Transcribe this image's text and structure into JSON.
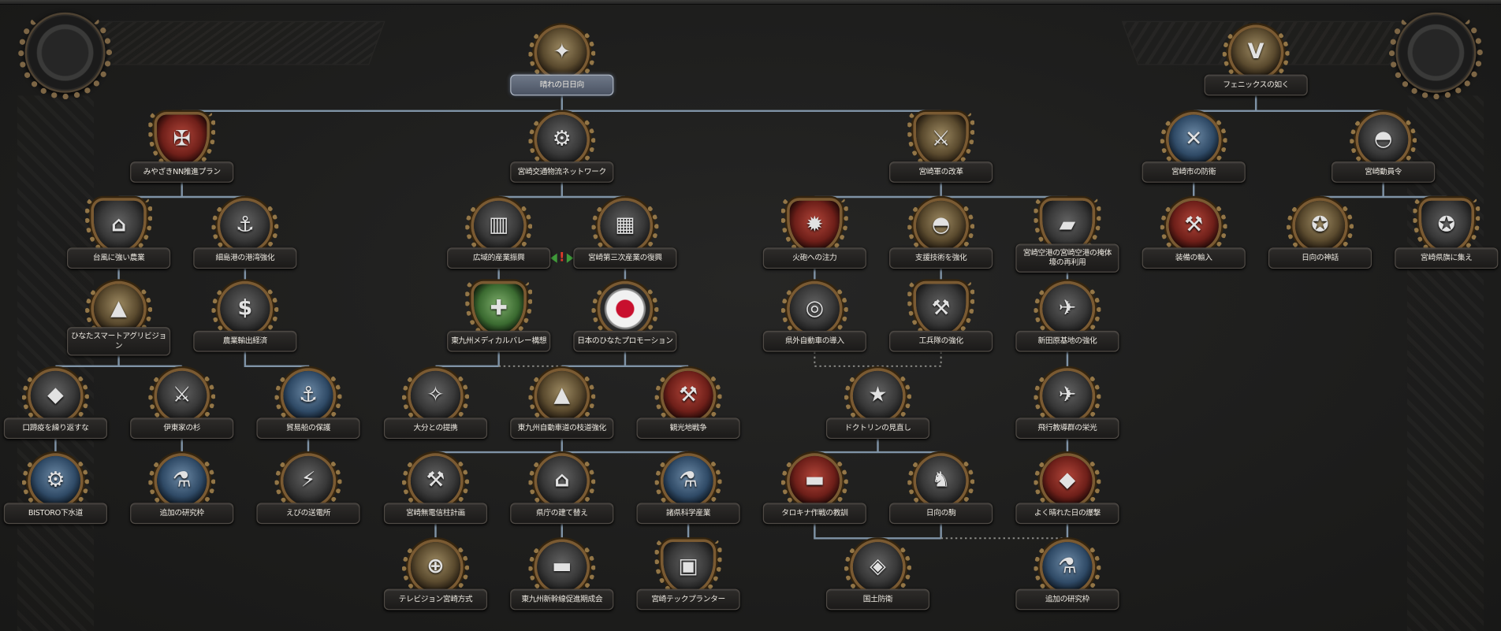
{
  "focus_tree": {
    "focuses": [
      {
        "label": "晴れの日日向",
        "icon": "torch-icon"
      },
      {
        "label": "フェニックスの如く",
        "icon": "phoenix-v-icon"
      },
      {
        "label": "みやざきNN推進プラン",
        "icon": "iron-cross-icon"
      },
      {
        "label": "宮崎交通物流ネットワーク",
        "icon": "logistics-icon"
      },
      {
        "label": "宮崎軍の改革",
        "icon": "crossed-swords-icon"
      },
      {
        "label": "宮崎市の防衛",
        "icon": "crossed-rifles-icon"
      },
      {
        "label": "宮崎動員令",
        "icon": "helmet-icon"
      },
      {
        "label": "台風に強い農業",
        "icon": "farm-icon"
      },
      {
        "label": "細島港の港湾強化",
        "icon": "port-icon"
      },
      {
        "label": "広域的産業振興",
        "icon": "factory-icon"
      },
      {
        "label": "宮崎第三次産業の復興",
        "icon": "city-icon"
      },
      {
        "label": "火砲への注力",
        "icon": "artillery-icon"
      },
      {
        "label": "支援技術を強化",
        "icon": "pith-helmet-icon"
      },
      {
        "label": "宮崎空港の宮崎空港の掩体壕の再利用",
        "icon": "bunker-icon"
      },
      {
        "label": "装備の輸入",
        "icon": "import-equipment-icon"
      },
      {
        "label": "日向の神話",
        "icon": "fist-icon"
      },
      {
        "label": "宮崎県旗に集え",
        "icon": "rally-fist-icon"
      },
      {
        "label": "ひなたスマートアグリビジョン",
        "icon": "smart-agri-icon"
      },
      {
        "label": "農業輸出経済",
        "icon": "money-icon"
      },
      {
        "label": "東九州メディカルバレー構想",
        "icon": "medical-shield-icon"
      },
      {
        "label": "日本のひなたプロモーション",
        "icon": "japan-flag-icon"
      },
      {
        "label": "県外自動車の導入",
        "icon": "tire-icon"
      },
      {
        "label": "工兵隊の強化",
        "icon": "engineer-icon"
      },
      {
        "label": "新田原基地の強化",
        "icon": "jet-icon"
      },
      {
        "label": "口蹄疫を繰り返すな",
        "icon": "shield-icon"
      },
      {
        "label": "伊東家の杉",
        "icon": "crossed-axes-icon"
      },
      {
        "label": "貿易船の保護",
        "icon": "ship-icon"
      },
      {
        "label": "大分との提携",
        "icon": "handshake-icon"
      },
      {
        "label": "東九州自動車道の枝道強化",
        "icon": "road-icon"
      },
      {
        "label": "観光地戦争",
        "icon": "tourism-war-icon"
      },
      {
        "label": "ドクトリンの見直し",
        "icon": "doctrine-icon"
      },
      {
        "label": "飛行教導群の栄光",
        "icon": "flight-group-icon"
      },
      {
        "label": "BISTORO下水道",
        "icon": "sewer-icon"
      },
      {
        "label": "追加の研究枠",
        "icon": "flask-icon"
      },
      {
        "label": "えびの送電所",
        "icon": "power-plant-icon"
      },
      {
        "label": "宮崎無電信柱計画",
        "icon": "utility-pole-icon"
      },
      {
        "label": "県庁の建て替え",
        "icon": "government-building-icon"
      },
      {
        "label": "諸県科学産業",
        "icon": "science-flask-icon"
      },
      {
        "label": "タロキナ作戦の教訓",
        "icon": "tank-icon"
      },
      {
        "label": "日向の駒",
        "icon": "chess-knight-icon"
      },
      {
        "label": "よく晴れた日の爆撃",
        "icon": "bomb-icon"
      },
      {
        "label": "テレビジョン宮崎方式",
        "icon": "tv-antenna-icon"
      },
      {
        "label": "東九州新幹線促進期成会",
        "icon": "train-icon"
      },
      {
        "label": "宮崎テックプランター",
        "icon": "tech-planter-icon"
      },
      {
        "label": "国土防衛",
        "icon": "homeland-shield-icon"
      },
      {
        "label": "追加の研究枠",
        "icon": "flask-icon"
      }
    ],
    "exclusive_marker": {
      "icon": "mutually-exclusive-icon"
    }
  },
  "colors": {
    "background": "#1e1e1d",
    "connector_line": "#7f93a6",
    "optional_connector": "#8a8a86",
    "label_text": "#ece8e0",
    "highlighted_label": "#5c6576",
    "medal_bronze": "#7a5a32"
  }
}
